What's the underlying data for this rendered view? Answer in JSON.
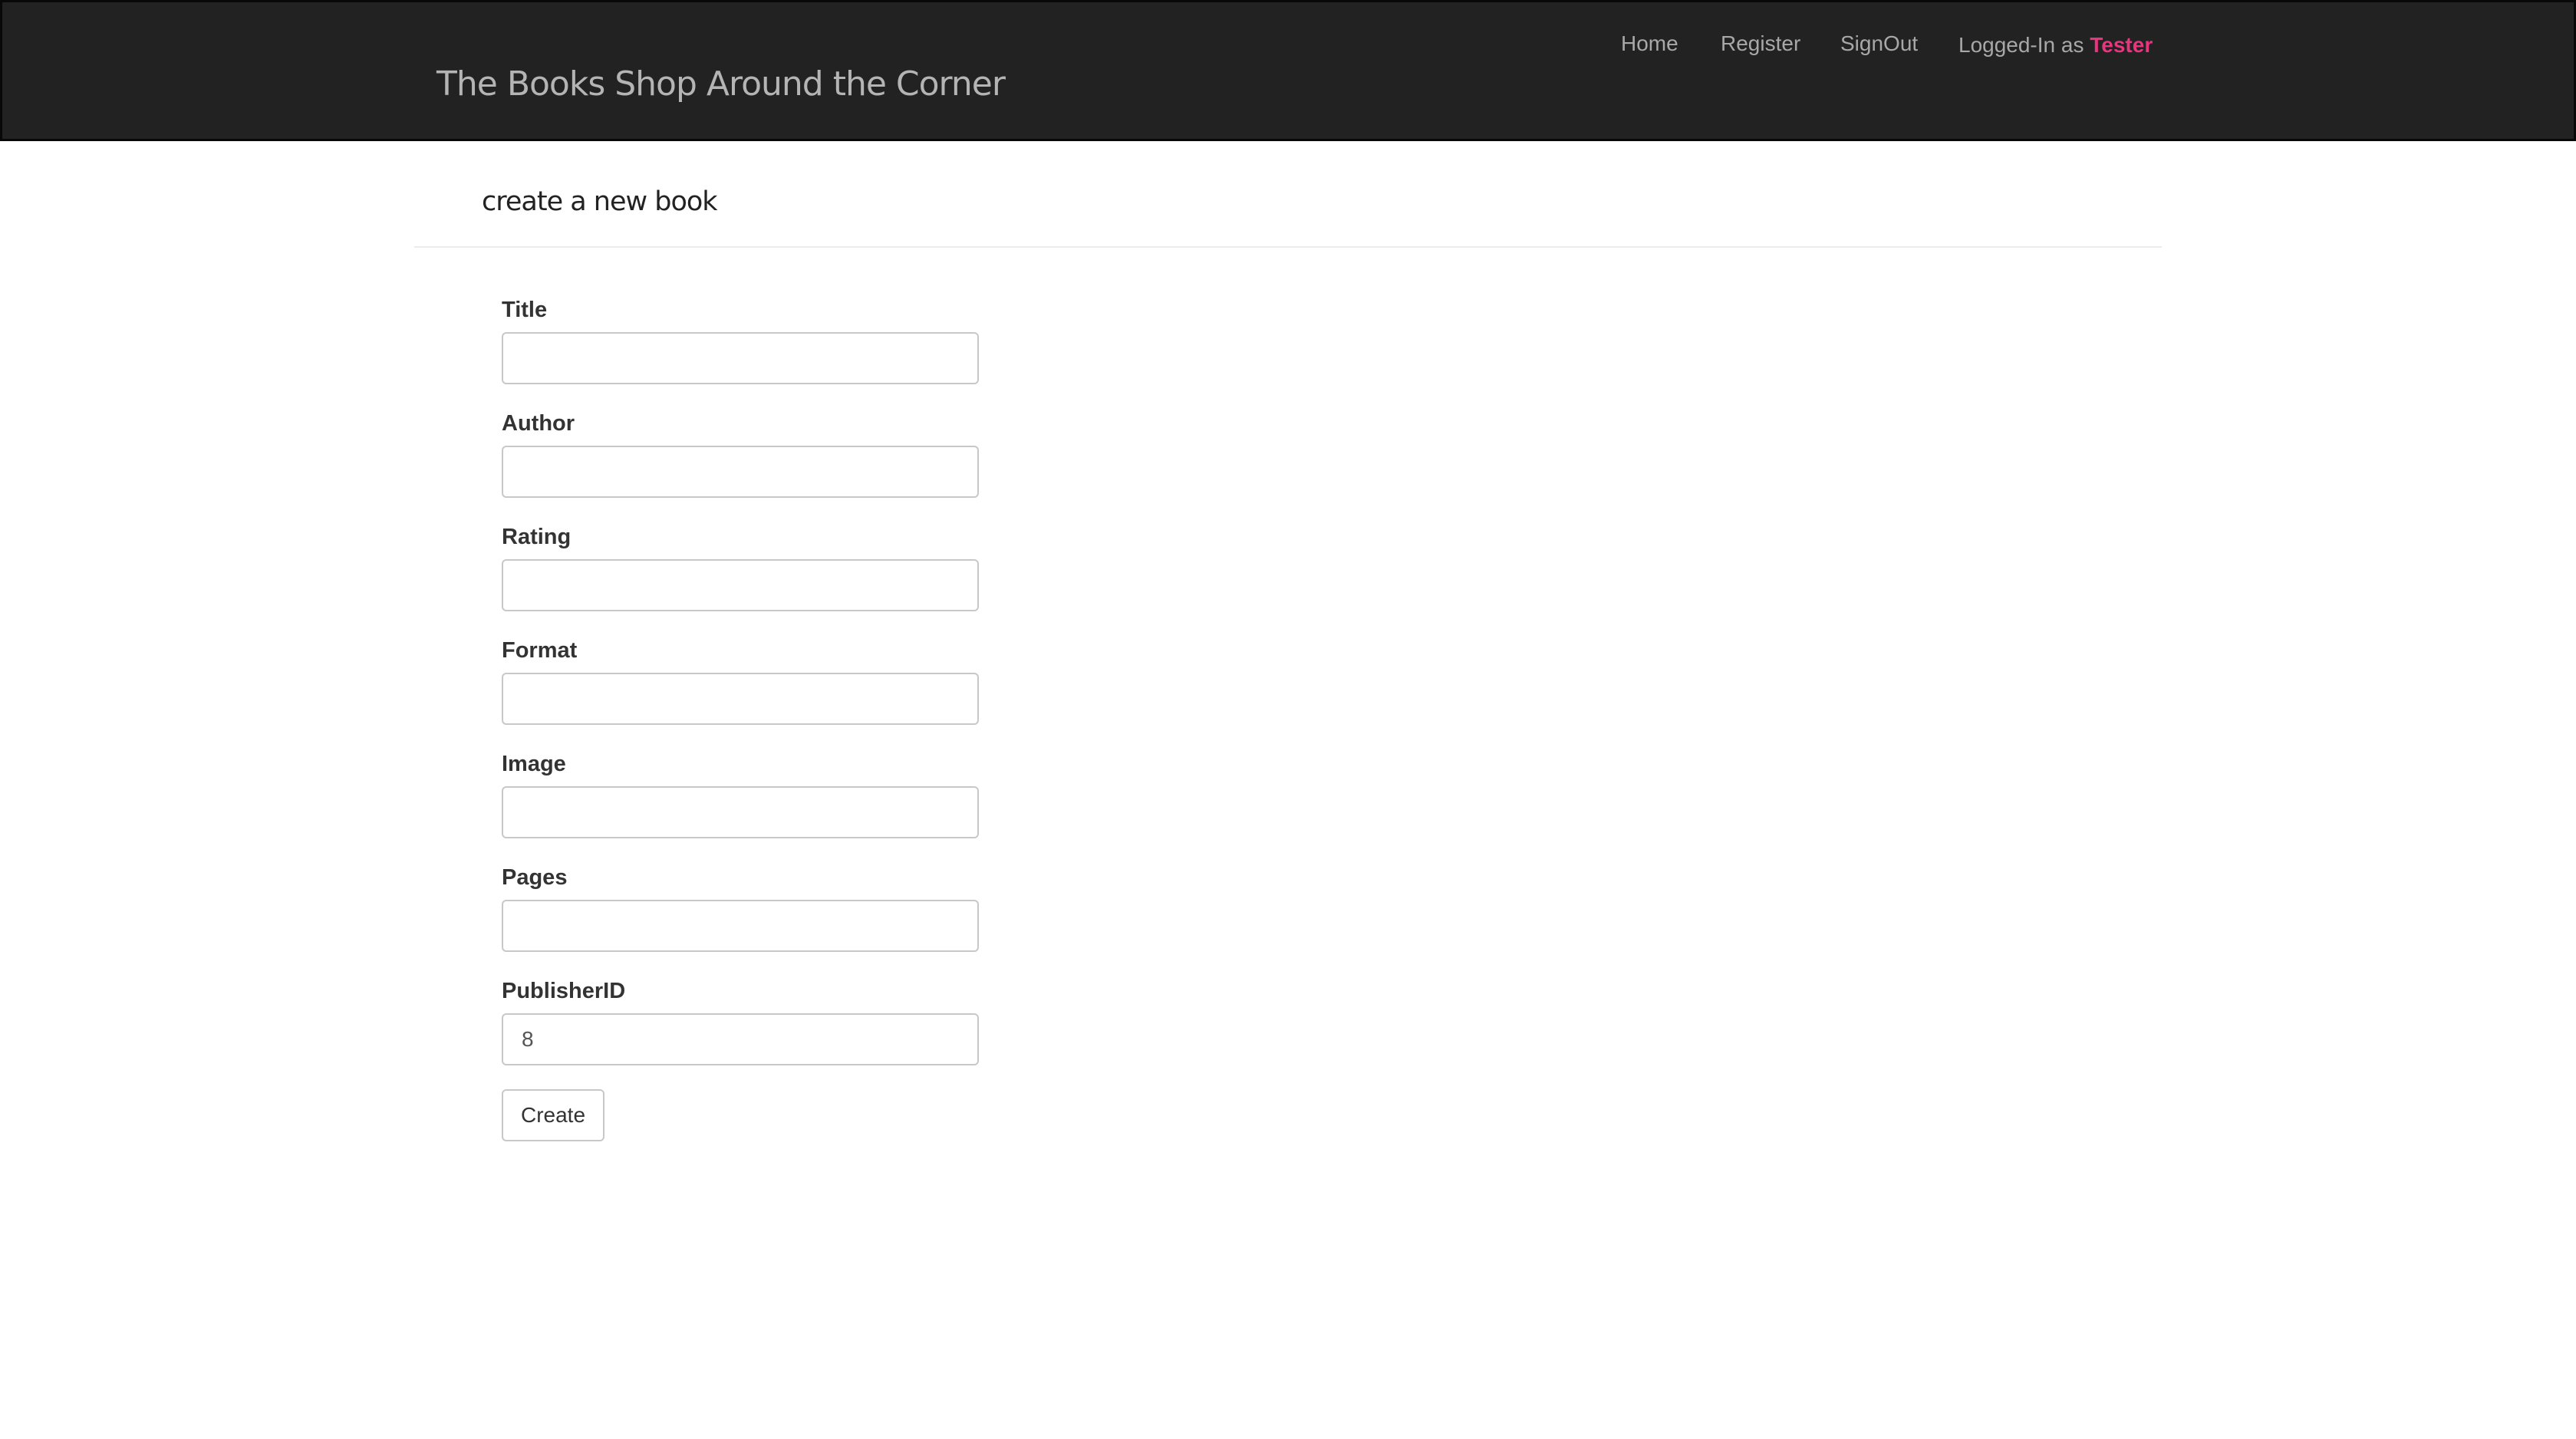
{
  "navbar": {
    "brand": "The Books Shop Around the Corner",
    "links": {
      "home": "Home",
      "register": "Register",
      "signout": "SignOut"
    },
    "user_prefix": "Logged-In as ",
    "user_name": "Tester"
  },
  "page": {
    "header": "create a new book"
  },
  "form": {
    "fields": [
      {
        "label": "Title",
        "value": ""
      },
      {
        "label": "Author",
        "value": ""
      },
      {
        "label": "Rating",
        "value": ""
      },
      {
        "label": "Format",
        "value": ""
      },
      {
        "label": "Image",
        "value": ""
      },
      {
        "label": "Pages",
        "value": ""
      },
      {
        "label": "PublisherID",
        "value": "8"
      }
    ],
    "submit_label": "Create"
  },
  "colors": {
    "navbar_background": "#222222",
    "user_name_accent": "#e8357e"
  }
}
